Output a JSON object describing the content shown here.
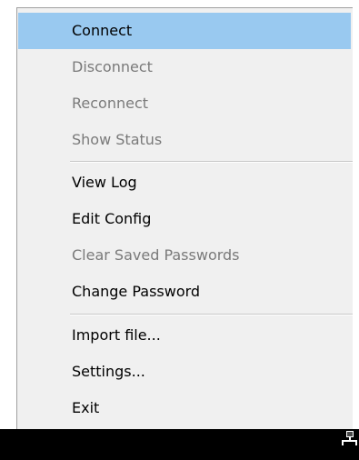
{
  "menu": {
    "items": [
      {
        "label": "Connect",
        "state": "highlighted"
      },
      {
        "label": "Disconnect",
        "state": "disabled"
      },
      {
        "label": "Reconnect",
        "state": "disabled"
      },
      {
        "label": "Show Status",
        "state": "disabled"
      },
      {
        "label": "View Log",
        "state": "enabled"
      },
      {
        "label": "Edit Config",
        "state": "enabled"
      },
      {
        "label": "Clear Saved Passwords",
        "state": "disabled"
      },
      {
        "label": "Change Password",
        "state": "enabled"
      },
      {
        "label": "Import file...",
        "state": "enabled"
      },
      {
        "label": "Settings...",
        "state": "enabled"
      },
      {
        "label": "Exit",
        "state": "enabled"
      }
    ]
  },
  "taskbar": {
    "tray_icon": "network-icon"
  },
  "colors": {
    "highlight": "#99c9f0",
    "menu_background": "#f0f0f0",
    "disabled_text": "#7a7a7a",
    "taskbar": "#000000"
  }
}
